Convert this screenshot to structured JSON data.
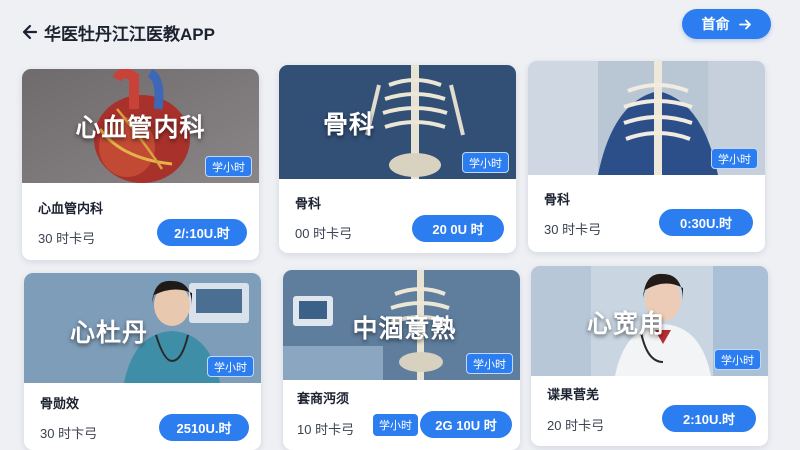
{
  "header": {
    "title": "华医牡丹江江医教APP",
    "home_label": "首俞",
    "back_icon": "arrow-left-icon",
    "home_icon": "arrow-right-icon"
  },
  "cards": [
    {
      "overlay": "心血管内科",
      "badge": "学小时",
      "name": "心血管内科",
      "duration": "30 时卡弓",
      "button": "2/:10U.时"
    },
    {
      "overlay": "骨科",
      "badge": "学小时",
      "name": "骨科",
      "duration": "00 时卡弓",
      "button": "20 0U 时"
    },
    {
      "overlay": "",
      "badge": "学小时",
      "name": "骨科",
      "duration": "30 时卡弓",
      "button": "0:30U.时"
    },
    {
      "overlay": "心杜丹",
      "badge": "学小时",
      "name": "骨勋效",
      "duration": "30 时卞弓",
      "button": "2510U.时"
    },
    {
      "overlay": "中涸意熟",
      "badge": "学小时",
      "name": "套商沔须",
      "duration": "10 时卡弓",
      "button": "2G 10U 时",
      "extra_badge": "学小时"
    },
    {
      "overlay": "心宽甪",
      "badge": "学小时",
      "name": "谍果菅羌",
      "duration": "20 时卡弓",
      "button": "2:10U.时"
    }
  ],
  "colors": {
    "accent": "#2b7df0",
    "background": "#eef0f4"
  }
}
